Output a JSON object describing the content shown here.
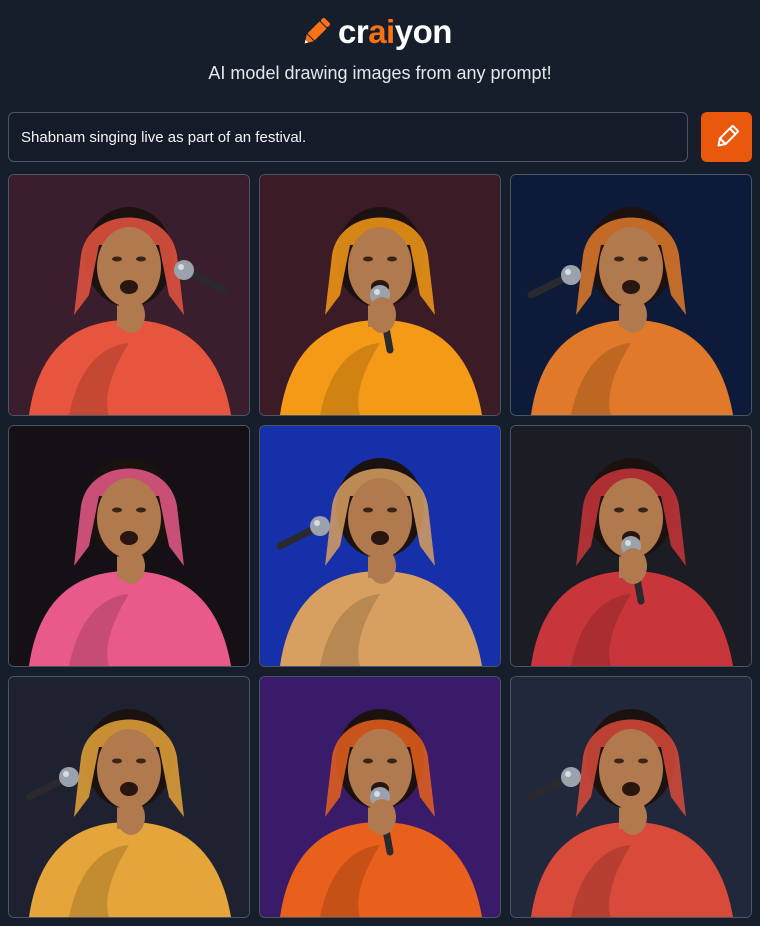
{
  "brand": {
    "logo_text_start": "cr",
    "logo_text_accent": "ai",
    "logo_text_end": "yon",
    "accent_color": "#f97316",
    "logo_icon": "pencil-icon"
  },
  "tagline": "AI model drawing images from any prompt!",
  "prompt": {
    "value": "Shabnam singing live as part of an festival.",
    "placeholder": "",
    "draw_button_icon": "pencil-icon",
    "draw_button_color": "#ea580c"
  },
  "results": {
    "count": 9,
    "images": [
      {
        "subject": "woman in red sari singing into handheld microphone",
        "bg": "#3a1e2e",
        "garment": "#e8553f",
        "mic_side": "right"
      },
      {
        "subject": "woman in orange sari holding microphone with both hands",
        "bg": "#3a1b26",
        "garment": "#f59a16",
        "mic_side": "center"
      },
      {
        "subject": "woman in orange sari at microphone stand",
        "bg": "#0e1a3a",
        "garment": "#e07a2a",
        "mic_side": "left"
      },
      {
        "subject": "woman in pink and gold sari covering mouth",
        "bg": "#141015",
        "garment": "#e85a8a",
        "mic_side": "none"
      },
      {
        "subject": "woman singing into blue microphone under blue light",
        "bg": "#1530a8",
        "garment": "#d8a060",
        "mic_side": "left"
      },
      {
        "subject": "woman in red printed sari holding microphone",
        "bg": "#1b1c24",
        "garment": "#c8353a",
        "mic_side": "center"
      },
      {
        "subject": "woman in yellow sari with microphone on stand",
        "bg": "#1e2230",
        "garment": "#e6a53a",
        "mic_side": "left"
      },
      {
        "subject": "woman in orange sari on purple-lit stage",
        "bg": "#3a1b6a",
        "garment": "#e8601c",
        "mic_side": "center"
      },
      {
        "subject": "woman in red sari singing into microphone",
        "bg": "#22283c",
        "garment": "#d84a3a",
        "mic_side": "left"
      }
    ]
  }
}
